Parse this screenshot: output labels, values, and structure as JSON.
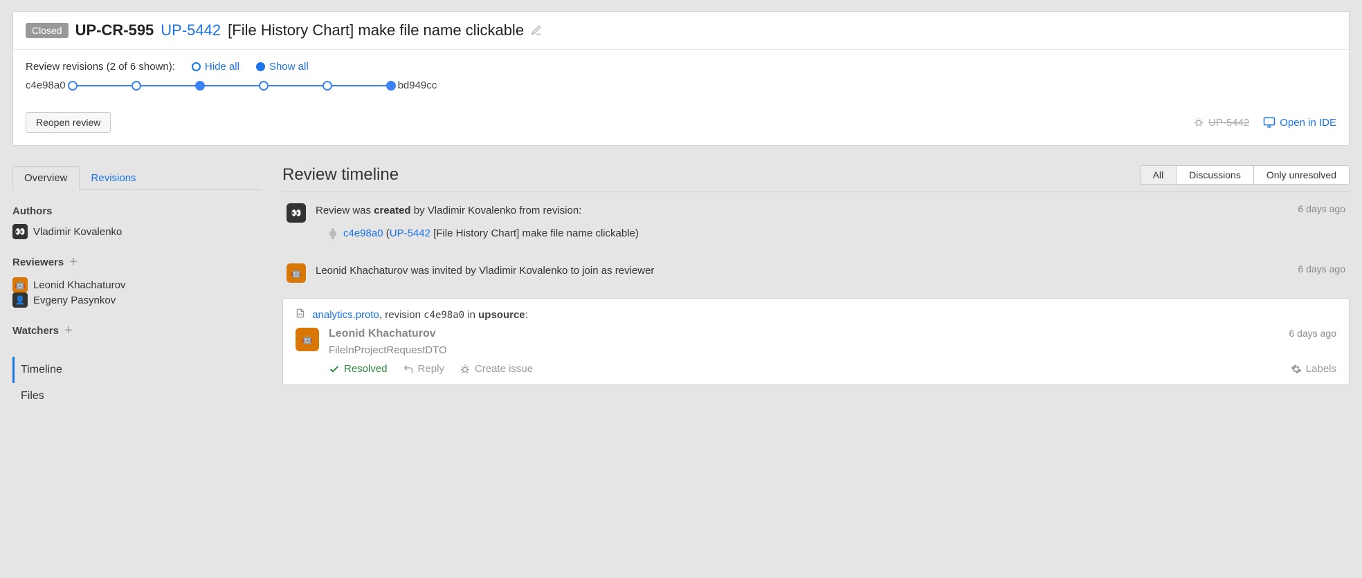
{
  "header": {
    "status_badge": "Closed",
    "review_id": "UP-CR-595",
    "issue_key": "UP-5442",
    "title": "[File History Chart] make file name clickable"
  },
  "revisions": {
    "label": "Review revisions (2 of 6 shown):",
    "hide_all": "Hide all",
    "show_all": "Show all",
    "start_hash": "c4e98a0",
    "end_hash": "bd949cc"
  },
  "actions": {
    "reopen": "Reopen review",
    "linked_issue": "UP-5442",
    "open_ide": "Open in IDE"
  },
  "tabs": {
    "overview": "Overview",
    "revisions": "Revisions"
  },
  "sidebar": {
    "authors_label": "Authors",
    "author_name": "Vladimir Kovalenko",
    "reviewers_label": "Reviewers",
    "reviewer1": "Leonid Khachaturov",
    "reviewer2": "Evgeny Pasynkov",
    "watchers_label": "Watchers",
    "nav_timeline": "Timeline",
    "nav_files": "Files"
  },
  "main": {
    "title": "Review timeline",
    "filters": {
      "all": "All",
      "discussions": "Discussions",
      "unresolved": "Only unresolved"
    }
  },
  "timeline": {
    "item1": {
      "pre": "Review was ",
      "bold": "created",
      "post": " by Vladimir Kovalenko from revision:",
      "time": "6 days ago",
      "commit": "c4e98a0",
      "issue": "UP-5442",
      "commit_title": " [File History Chart] make file name clickable)"
    },
    "item2": {
      "text": "Leonid Khachaturov was invited by Vladimir Kovalenko to join as reviewer",
      "time": "6 days ago"
    }
  },
  "discussion": {
    "file": "analytics.proto",
    "rev_pre": ", revision ",
    "rev_hash": "c4e98a0",
    "rev_mid": " in ",
    "project": "upsource",
    "colon": ":",
    "author": "Leonid Khachaturov",
    "time": "6 days ago",
    "text": "FileInProjectRequestDTO",
    "resolved": "Resolved",
    "reply": "Reply",
    "create_issue": "Create issue",
    "labels": "Labels"
  }
}
